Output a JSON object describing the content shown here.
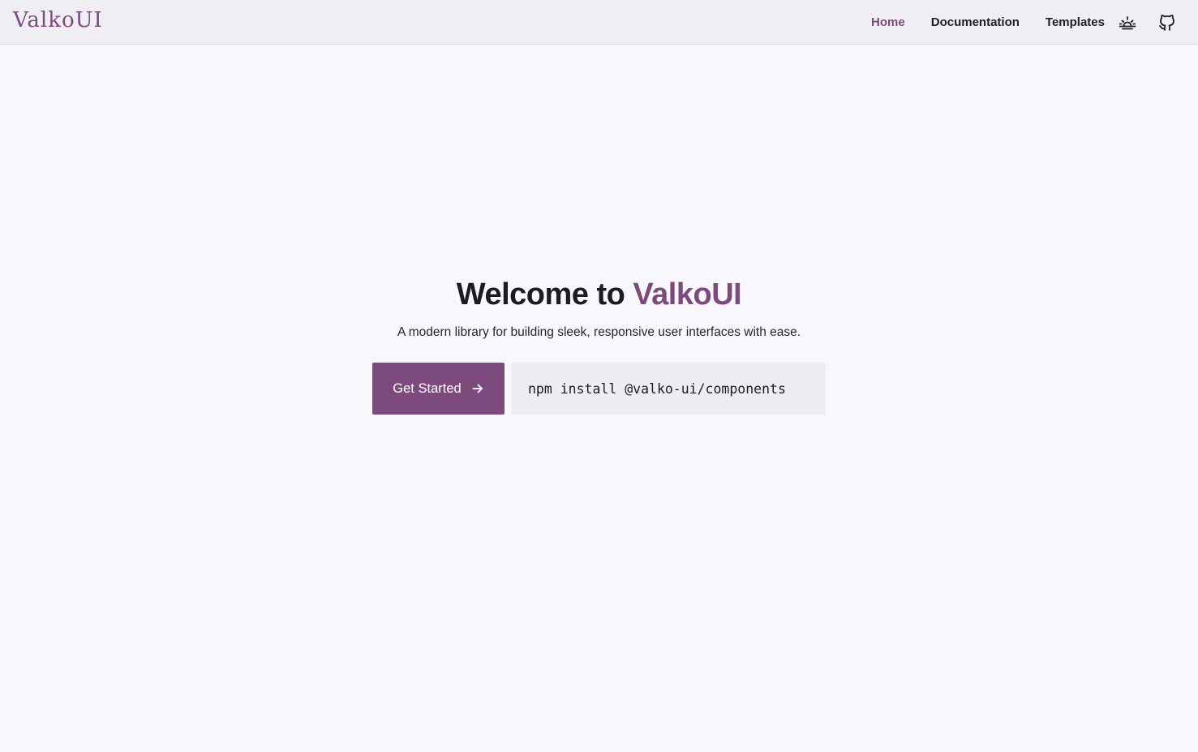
{
  "header": {
    "brand": "ValkoUI",
    "nav": [
      {
        "label": "Home",
        "active": true
      },
      {
        "label": "Documentation",
        "active": false
      },
      {
        "label": "Templates",
        "active": false
      }
    ],
    "icons": [
      "theme-toggle-sun-icon",
      "github-icon"
    ]
  },
  "hero": {
    "title_prefix": "Welcome to",
    "title_accent": "ValkoUI",
    "subtitle": "A modern library for building sleek, responsive user interfaces with ease.",
    "cta_label": "Get Started",
    "install_command": "npm install @valko-ui/components"
  },
  "colors": {
    "accent": "#7d4a7e",
    "background": "#f8f7fc",
    "header_bg": "#eeeef3",
    "code_bg": "#edeef2"
  }
}
